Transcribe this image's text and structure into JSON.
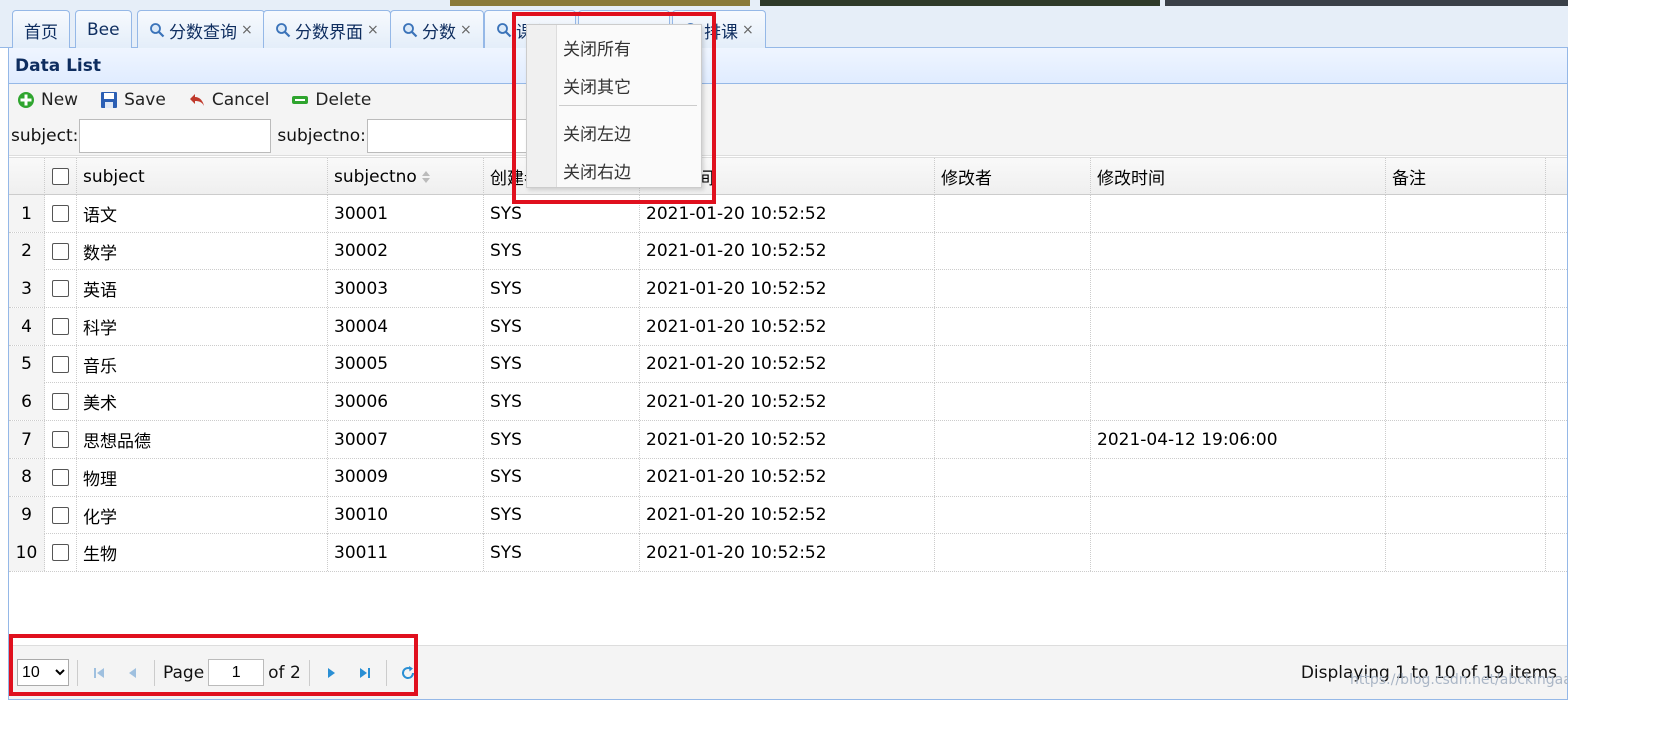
{
  "tabs": [
    {
      "label": "首页",
      "icon": "",
      "closable": false
    },
    {
      "label": "Bee",
      "icon": "",
      "closable": false
    },
    {
      "label": "分数查询",
      "icon": "search-icon",
      "closable": true
    },
    {
      "label": "分数界面",
      "icon": "search-icon",
      "closable": true
    },
    {
      "label": "分数",
      "icon": "search-icon",
      "closable": true
    },
    {
      "label": "课程",
      "icon": "search-icon",
      "closable": false
    },
    {
      "label": "排课",
      "icon": "search-icon",
      "closable": true
    }
  ],
  "tab_close_glyph": "×",
  "panel": {
    "title": "Data List"
  },
  "toolbar": {
    "new_label": "New",
    "save_label": "Save",
    "cancel_label": "Cancel",
    "delete_label": "Delete"
  },
  "filters": {
    "subject_label": "subject:",
    "subject_value": "",
    "subjectno_label": "subjectno:",
    "subjectno_value": ""
  },
  "grid": {
    "columns": [
      "subject",
      "subjectno",
      "创建者",
      "创建时间",
      "修改者",
      "修改时间",
      "备注"
    ],
    "rows": [
      {
        "num": "1",
        "subject": "语文",
        "subjectno": "30001",
        "creator": "SYS",
        "created": "2021-01-20 10:52:52",
        "modifier": "",
        "modified": "",
        "note": ""
      },
      {
        "num": "2",
        "subject": "数学",
        "subjectno": "30002",
        "creator": "SYS",
        "created": "2021-01-20 10:52:52",
        "modifier": "",
        "modified": "",
        "note": ""
      },
      {
        "num": "3",
        "subject": "英语",
        "subjectno": "30003",
        "creator": "SYS",
        "created": "2021-01-20 10:52:52",
        "modifier": "",
        "modified": "",
        "note": ""
      },
      {
        "num": "4",
        "subject": "科学",
        "subjectno": "30004",
        "creator": "SYS",
        "created": "2021-01-20 10:52:52",
        "modifier": "",
        "modified": "",
        "note": ""
      },
      {
        "num": "5",
        "subject": "音乐",
        "subjectno": "30005",
        "creator": "SYS",
        "created": "2021-01-20 10:52:52",
        "modifier": "",
        "modified": "",
        "note": ""
      },
      {
        "num": "6",
        "subject": "美术",
        "subjectno": "30006",
        "creator": "SYS",
        "created": "2021-01-20 10:52:52",
        "modifier": "",
        "modified": "",
        "note": ""
      },
      {
        "num": "7",
        "subject": "思想品德",
        "subjectno": "30007",
        "creator": "SYS",
        "created": "2021-01-20 10:52:52",
        "modifier": "",
        "modified": "2021-04-12 19:06:00",
        "note": ""
      },
      {
        "num": "8",
        "subject": "物理",
        "subjectno": "30009",
        "creator": "SYS",
        "created": "2021-01-20 10:52:52",
        "modifier": "",
        "modified": "",
        "note": ""
      },
      {
        "num": "9",
        "subject": "化学",
        "subjectno": "30010",
        "creator": "SYS",
        "created": "2021-01-20 10:52:52",
        "modifier": "",
        "modified": "",
        "note": ""
      },
      {
        "num": "10",
        "subject": "生物",
        "subjectno": "30011",
        "creator": "SYS",
        "created": "2021-01-20 10:52:52",
        "modifier": "",
        "modified": "",
        "note": ""
      }
    ]
  },
  "context_menu": {
    "items": [
      "关闭所有",
      "关闭其它",
      "关闭左边",
      "关闭右边"
    ]
  },
  "pager": {
    "page_size": "10",
    "page_label": "Page",
    "page_value": "1",
    "of_label": "of 2",
    "info": "Displaying 1 to 10 of 19 items"
  },
  "watermark": "https://blog.csdn.net/abckingaa",
  "colors": {
    "header_blue": "#0e2d5f",
    "border_blue": "#95b8e7",
    "highlight_red": "#e0101e",
    "pager_blue": "#2a8fd4"
  }
}
